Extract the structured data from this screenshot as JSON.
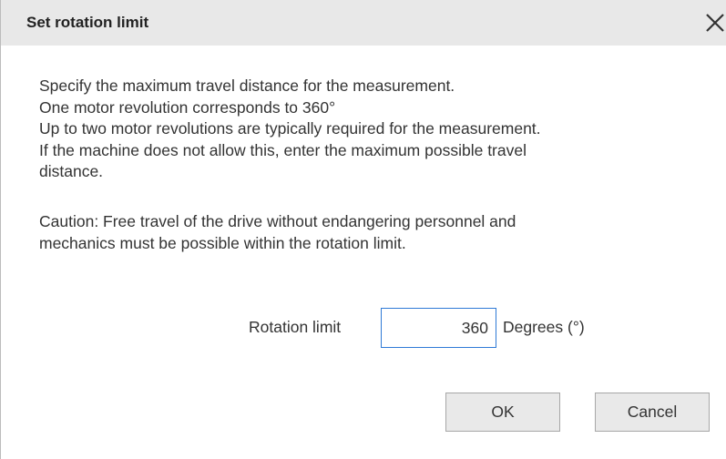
{
  "dialog": {
    "title": "Set rotation limit",
    "close_icon": "close-icon"
  },
  "message": {
    "lines": [
      "Specify the maximum travel distance for the measurement.",
      "One motor revolution corresponds to 360°",
      "Up to two motor revolutions are typically required for the measurement.",
      "If the machine does not allow this, enter the maximum possible travel",
      "distance."
    ]
  },
  "caution": {
    "lines": [
      "Caution: Free travel of the drive without endangering personnel and",
      "mechanics must be possible within the rotation limit."
    ]
  },
  "rotation_limit": {
    "label": "Rotation limit",
    "value": "360",
    "unit": "Degrees (°)"
  },
  "buttons": {
    "ok_label": "OK",
    "cancel_label": "Cancel"
  },
  "colors": {
    "titlebar": "#e8e8e8",
    "input_focus_border": "#2f7ad6",
    "button_bg": "#e9e9e9"
  }
}
